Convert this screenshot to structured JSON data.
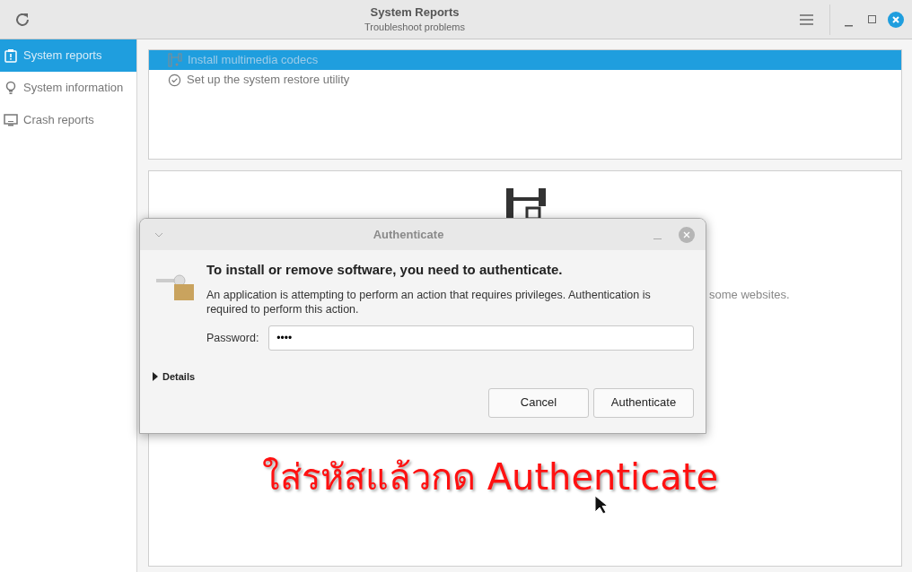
{
  "window": {
    "title": "System Reports",
    "subtitle": "Troubleshoot problems"
  },
  "sidebar": {
    "items": [
      {
        "label": "System reports",
        "selected": true,
        "kind": "report"
      },
      {
        "label": "System information",
        "selected": false,
        "kind": "info"
      },
      {
        "label": "Crash reports",
        "selected": false,
        "kind": "crash"
      }
    ]
  },
  "reports": [
    {
      "label": "Install multimedia codecs",
      "selected": true,
      "kind": "codecs"
    },
    {
      "label": "Set up the system restore utility",
      "selected": false,
      "kind": "restore"
    }
  ],
  "detail": {
    "text": "some websites."
  },
  "dialog": {
    "title": "Authenticate",
    "heading": "To install or remove software, you need to authenticate.",
    "message": "An application is attempting to perform an action that requires privileges. Authentication is required to perform this action.",
    "password_label": "Password:",
    "password_value": "••••",
    "details": {
      "label": "Details",
      "expanded": false
    },
    "buttons": [
      "Cancel",
      "Authenticate"
    ]
  },
  "annotation": "ใส่รหัสแล้วกด Authenticate"
}
